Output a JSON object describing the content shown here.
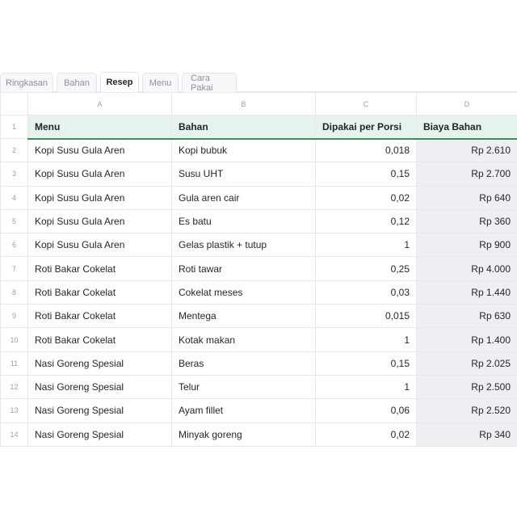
{
  "tabs": [
    {
      "label": "Ringkasan",
      "active": false
    },
    {
      "label": "Bahan",
      "active": false
    },
    {
      "label": "Resep",
      "active": true
    },
    {
      "label": "Menu",
      "active": false
    },
    {
      "label": "Cara Pakai",
      "active": false
    }
  ],
  "columns": [
    "A",
    "B",
    "C",
    "D"
  ],
  "header": {
    "row_number": "1",
    "cells": [
      "Menu",
      "Bahan",
      "Dipakai per Porsi",
      "Biaya Bahan"
    ]
  },
  "rows": [
    {
      "num": "2",
      "menu": "Kopi Susu Gula Aren",
      "bahan": "Kopi bubuk",
      "porsi": "0,018",
      "biaya": "Rp 2.610"
    },
    {
      "num": "3",
      "menu": "Kopi Susu Gula Aren",
      "bahan": "Susu UHT",
      "porsi": "0,15",
      "biaya": "Rp 2.700"
    },
    {
      "num": "4",
      "menu": "Kopi Susu Gula Aren",
      "bahan": "Gula aren cair",
      "porsi": "0,02",
      "biaya": "Rp 640"
    },
    {
      "num": "5",
      "menu": "Kopi Susu Gula Aren",
      "bahan": "Es batu",
      "porsi": "0,12",
      "biaya": "Rp 360"
    },
    {
      "num": "6",
      "menu": "Kopi Susu Gula Aren",
      "bahan": "Gelas plastik + tutup",
      "porsi": "1",
      "biaya": "Rp 900"
    },
    {
      "num": "7",
      "menu": "Roti Bakar Cokelat",
      "bahan": "Roti tawar",
      "porsi": "0,25",
      "biaya": "Rp 4.000"
    },
    {
      "num": "8",
      "menu": "Roti Bakar Cokelat",
      "bahan": "Cokelat meses",
      "porsi": "0,03",
      "biaya": "Rp 1.440"
    },
    {
      "num": "9",
      "menu": "Roti Bakar Cokelat",
      "bahan": "Mentega",
      "porsi": "0,015",
      "biaya": "Rp 630"
    },
    {
      "num": "10",
      "menu": "Roti Bakar Cokelat",
      "bahan": "Kotak makan",
      "porsi": "1",
      "biaya": "Rp 1.400"
    },
    {
      "num": "11",
      "menu": "Nasi Goreng Spesial",
      "bahan": "Beras",
      "porsi": "0,15",
      "biaya": "Rp 2.025"
    },
    {
      "num": "12",
      "menu": "Nasi Goreng Spesial",
      "bahan": "Telur",
      "porsi": "1",
      "biaya": "Rp 2.500"
    },
    {
      "num": "13",
      "menu": "Nasi Goreng Spesial",
      "bahan": "Ayam fillet",
      "porsi": "0,06",
      "biaya": "Rp 2.520"
    },
    {
      "num": "14",
      "menu": "Nasi Goreng Spesial",
      "bahan": "Minyak goreng",
      "porsi": "0,02",
      "biaya": "Rp 340"
    }
  ],
  "colors": {
    "header_bg": "#e6f3ec",
    "header_underline": "#3e8b5e",
    "cost_column_bg": "#eeeff3",
    "gridline": "#e6e8ec"
  }
}
